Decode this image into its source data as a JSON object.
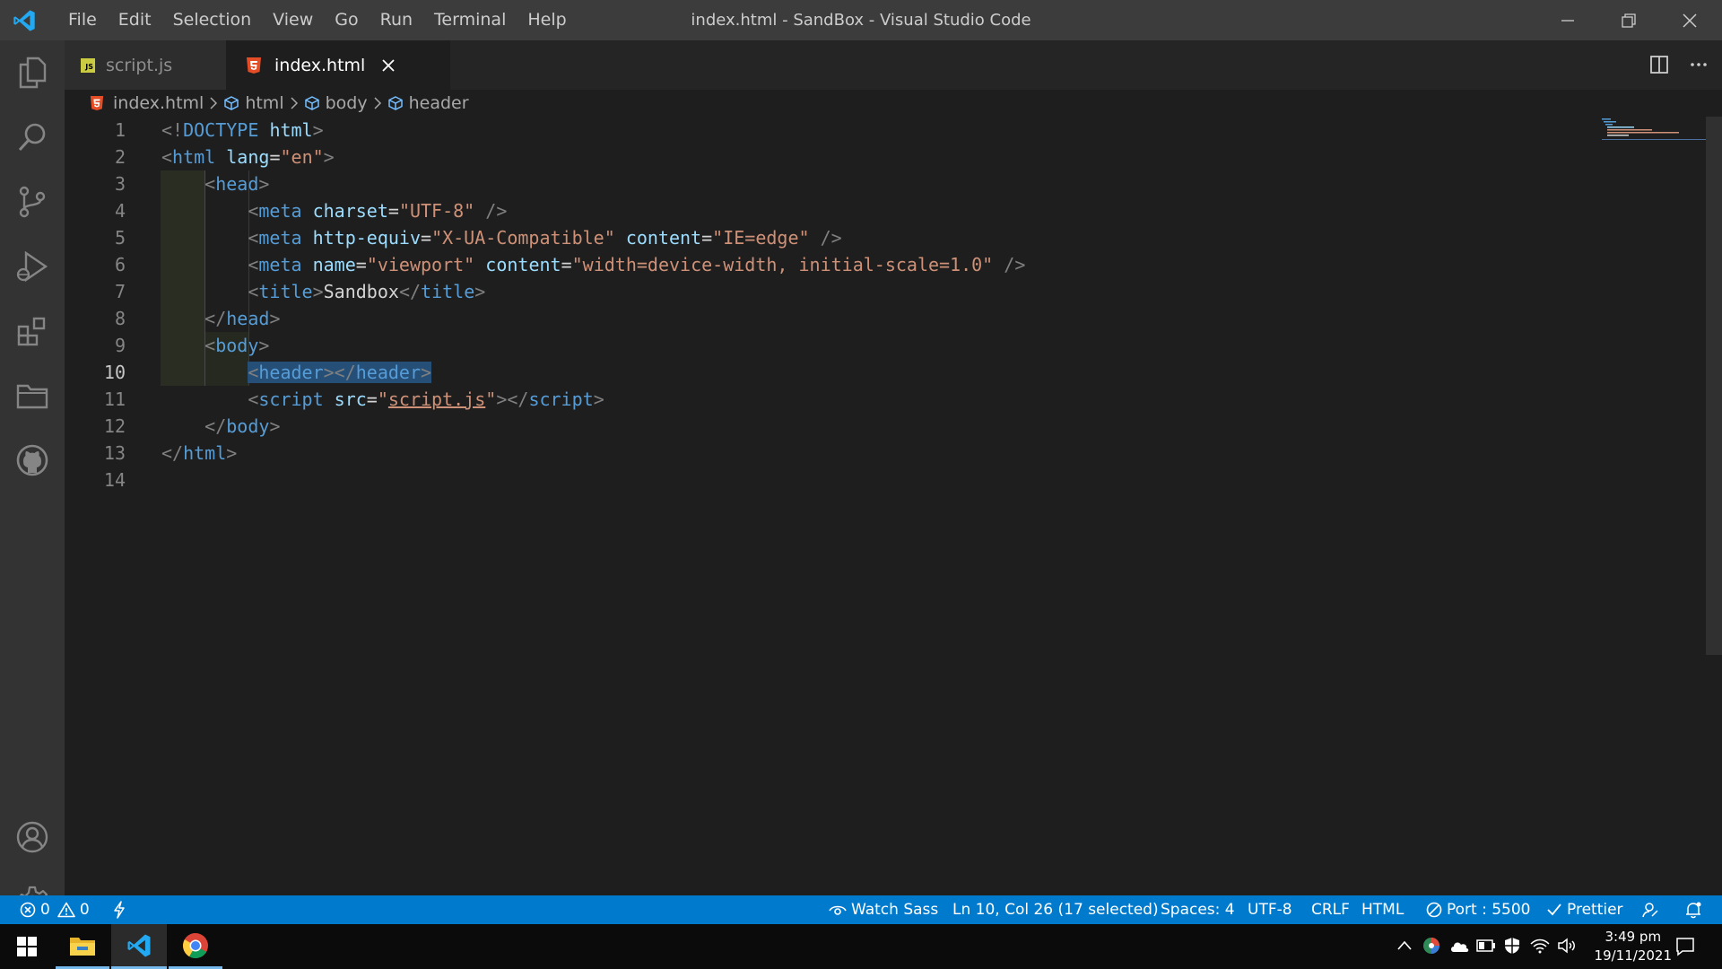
{
  "window": {
    "title": "index.html - SandBox - Visual Studio Code",
    "menu": [
      "File",
      "Edit",
      "Selection",
      "View",
      "Go",
      "Run",
      "Terminal",
      "Help"
    ]
  },
  "activity_bar": {
    "items": [
      "files-icon",
      "search-icon",
      "source-control-icon",
      "run-debug-icon",
      "extensions-icon",
      "folder-icon",
      "github-icon"
    ],
    "bottom": [
      "account-icon",
      "settings-gear-icon"
    ]
  },
  "tabs": [
    {
      "label": "script.js",
      "badge": "JS",
      "active": false
    },
    {
      "label": "index.html",
      "active": true
    }
  ],
  "breadcrumb": [
    "index.html",
    "html",
    "body",
    "header"
  ],
  "editor": {
    "current_line": 10,
    "line_numbers": [
      "1",
      "2",
      "3",
      "4",
      "5",
      "6",
      "7",
      "8",
      "9",
      "10",
      "11",
      "12",
      "13",
      "14"
    ],
    "tokens": {
      "l1": {
        "a": "<!",
        "b": "DOCTYPE",
        "c": "html",
        "d": ">"
      },
      "l2": {
        "tag": "html",
        "attr": "lang",
        "val": "\"en\""
      },
      "l3": {
        "tag": "head"
      },
      "l4": {
        "tag": "meta",
        "attr": "charset",
        "val": "\"UTF-8\""
      },
      "l5": {
        "tag": "meta",
        "attr1": "http-equiv",
        "val1": "\"X-UA-Compatible\"",
        "attr2": "content",
        "val2": "\"IE=edge\""
      },
      "l6": {
        "tag": "meta",
        "attr1": "name",
        "val1": "\"viewport\"",
        "attr2": "content",
        "val2": "\"width=device-width, initial-scale=1.0\""
      },
      "l7": {
        "tag": "title",
        "text": "Sandbox"
      },
      "l8": {
        "tag": "head"
      },
      "l9": {
        "tag": "body"
      },
      "l10": {
        "tag": "header"
      },
      "l11": {
        "tag": "script",
        "attr": "src",
        "q": "\"",
        "val": "script.js"
      },
      "l12": {
        "tag": "body"
      },
      "l13": {
        "tag": "html"
      }
    }
  },
  "status_bar": {
    "errors": "0",
    "warnings": "0",
    "watch_sass": "Watch Sass",
    "position": "Ln 10, Col 26 (17 selected)",
    "spaces": "Spaces: 4",
    "encoding": "UTF-8",
    "eol": "CRLF",
    "language": "HTML",
    "port": "Port : 5500",
    "prettier": "Prettier"
  },
  "taskbar": {
    "time": "3:49 pm",
    "date": "19/11/2021"
  },
  "colors": {
    "accent": "#007acc",
    "titlebar": "#3c3c3c",
    "activitybar": "#333333",
    "editor_bg": "#1e1e1e"
  }
}
